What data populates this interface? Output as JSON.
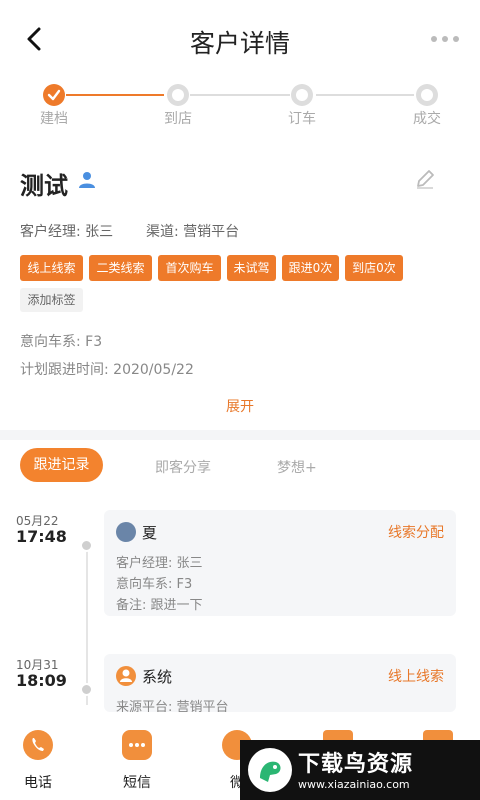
{
  "header": {
    "title": "客户详情"
  },
  "steps": [
    {
      "label": "建档",
      "done": true
    },
    {
      "label": "到店",
      "done": false
    },
    {
      "label": "订车",
      "done": false
    },
    {
      "label": "成交",
      "done": false
    }
  ],
  "customer": {
    "name": "测试",
    "manager": "客户经理: 张三",
    "channel": "渠道: 营销平台",
    "tags": [
      "线上线索",
      "二类线索",
      "首次购车",
      "未试驾",
      "跟进0次",
      "到店0次"
    ],
    "add_tag_label": "添加标签",
    "intended_series": "意向车系: F3",
    "plan_follow_time": "计划跟进时间: 2020/05/22",
    "expand_label": "展开"
  },
  "tabs": {
    "active": "跟进记录",
    "items": [
      "即客分享",
      "梦想+"
    ]
  },
  "timeline": [
    {
      "date": "05月22",
      "time": "17:48",
      "title": "夏",
      "tag": "线索分配",
      "lines": [
        "客户经理: 张三",
        "意向车系: F3",
        "备注: 跟进一下"
      ]
    },
    {
      "date": "10月31",
      "time": "18:09",
      "title": "系统",
      "tag": "线上线索",
      "lines": [
        "来源平台: 营销平台"
      ]
    }
  ],
  "bottom_nav": [
    {
      "label": "电话",
      "icon": "phone-icon"
    },
    {
      "label": "短信",
      "icon": "sms-icon"
    },
    {
      "label": "微",
      "icon": "wechat-icon"
    },
    {
      "label": "",
      "icon": "clipboard-icon"
    },
    {
      "label": "",
      "icon": "document-icon"
    }
  ],
  "watermark": {
    "title": "下载鸟资源",
    "url": "www.xiazainiao.com"
  },
  "colors": {
    "accent": "#f3832e",
    "tag_bg": "#ee7a2a",
    "muted": "#aaaaaa",
    "card_bg": "#f5f6f8"
  }
}
